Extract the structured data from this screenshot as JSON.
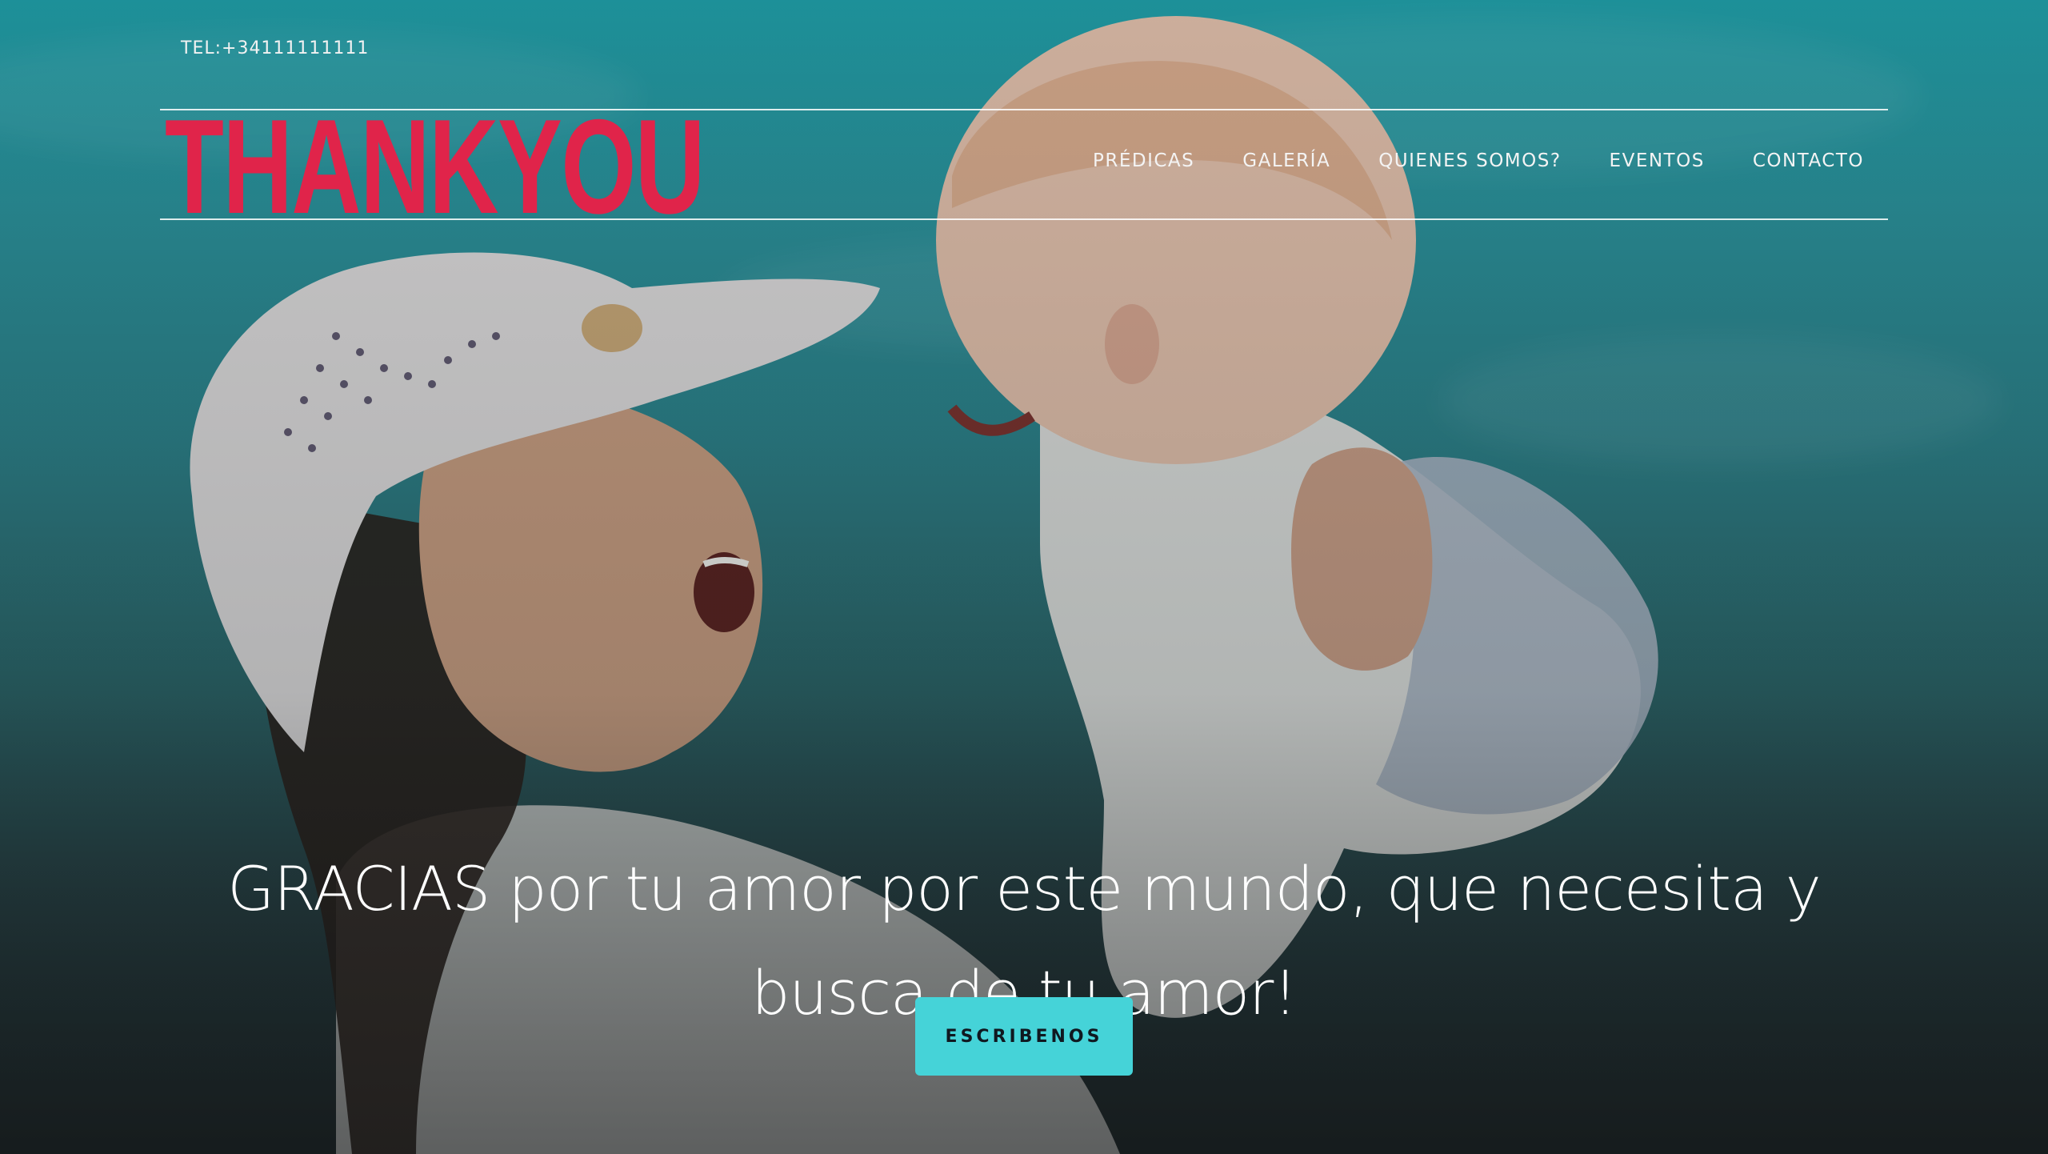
{
  "header": {
    "phone": "TEL:+34111111111",
    "logo_text": "THANKYOU",
    "nav": [
      {
        "label": "PRÉDICAS"
      },
      {
        "label": "GALERÍA"
      },
      {
        "label": "QUIENES SOMOS?"
      },
      {
        "label": "EVENTOS"
      },
      {
        "label": "CONTACTO"
      }
    ]
  },
  "hero": {
    "headline": "GRACIAS por tu amor por este mundo, que necesita y busca de tu amor!",
    "cta_label": "ESCRIBENOS",
    "background_image": "mother-holding-baby-photo"
  },
  "colors": {
    "logo": "#e0244a",
    "cta_background": "#45d3d8",
    "cta_text": "#101820",
    "sky_teal": "#1f9ca5"
  }
}
